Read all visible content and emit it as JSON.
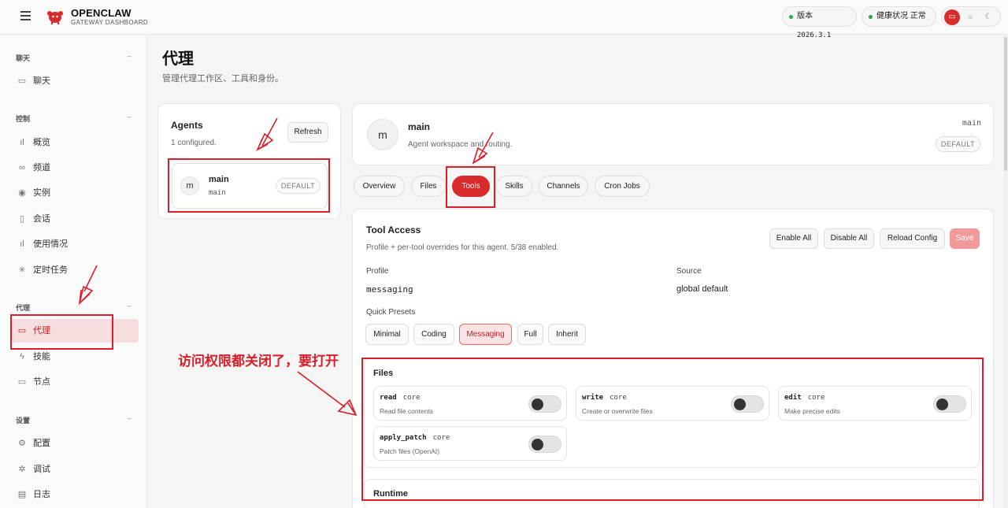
{
  "app": {
    "name": "OPENCLAW",
    "subtitle": "GATEWAY DASHBOARD"
  },
  "status": {
    "version_label": "版本",
    "version": "2026.3.1",
    "health_label": "健康状况",
    "health_value": "正常"
  },
  "sidebar": {
    "sections": [
      {
        "title": "聊天",
        "items": [
          {
            "label": "聊天",
            "icon": "chat-icon"
          }
        ]
      },
      {
        "title": "控制",
        "items": [
          {
            "label": "概览",
            "icon": "bar-chart-icon"
          },
          {
            "label": "频道",
            "icon": "link-icon"
          },
          {
            "label": "实例",
            "icon": "broadcast-icon"
          },
          {
            "label": "会话",
            "icon": "document-icon"
          },
          {
            "label": "使用情况",
            "icon": "bar-chart-icon"
          },
          {
            "label": "定时任务",
            "icon": "loader-icon"
          }
        ]
      },
      {
        "title": "代理",
        "items": [
          {
            "label": "代理",
            "icon": "folder-icon",
            "active": true
          },
          {
            "label": "技能",
            "icon": "zap-icon"
          },
          {
            "label": "节点",
            "icon": "monitor-icon"
          }
        ]
      },
      {
        "title": "设置",
        "items": [
          {
            "label": "配置",
            "icon": "gear-icon"
          },
          {
            "label": "调试",
            "icon": "bug-icon"
          },
          {
            "label": "日志",
            "icon": "log-icon"
          }
        ]
      }
    ]
  },
  "page": {
    "title": "代理",
    "subtitle": "管理代理工作区、工具和身份。"
  },
  "agents_panel": {
    "title": "Agents",
    "count": "1 configured.",
    "refresh": "Refresh",
    "agents": [
      {
        "avatar": "m",
        "name": "main",
        "id": "main",
        "badge": "DEFAULT"
      }
    ]
  },
  "agent_header": {
    "avatar": "m",
    "name": "main",
    "desc": "Agent workspace and routing.",
    "id": "main",
    "badge": "DEFAULT"
  },
  "tabs": [
    {
      "label": "Overview"
    },
    {
      "label": "Files"
    },
    {
      "label": "Tools",
      "active": true
    },
    {
      "label": "Skills"
    },
    {
      "label": "Channels"
    },
    {
      "label": "Cron Jobs"
    }
  ],
  "tool_access": {
    "title": "Tool Access",
    "desc": "Profile + per-tool overrides for this agent. 5/38 enabled.",
    "buttons": {
      "enable_all": "Enable All",
      "disable_all": "Disable All",
      "reload": "Reload Config",
      "save": "Save"
    },
    "profile_label": "Profile",
    "profile_value": "messaging",
    "source_label": "Source",
    "source_value": "global default",
    "presets_label": "Quick Presets",
    "presets": [
      {
        "label": "Minimal"
      },
      {
        "label": "Coding"
      },
      {
        "label": "Messaging",
        "active": true
      },
      {
        "label": "Full"
      },
      {
        "label": "Inherit"
      }
    ],
    "groups": [
      {
        "title": "Files",
        "tools": [
          {
            "name": "read",
            "tag": "core",
            "desc": "Read file contents",
            "enabled": false
          },
          {
            "name": "write",
            "tag": "core",
            "desc": "Create or overwrite files",
            "enabled": false
          },
          {
            "name": "edit",
            "tag": "core",
            "desc": "Make precise edits",
            "enabled": false
          },
          {
            "name": "apply_patch",
            "tag": "core",
            "desc": "Patch files (OpenAI)",
            "enabled": false
          }
        ]
      },
      {
        "title": "Runtime",
        "tools": []
      }
    ]
  },
  "annotation": {
    "text": "访问权限都关闭了，要打开",
    "color": "#d9202a"
  },
  "colors": {
    "accent": "#d92b2b",
    "active_nav_bg": "#f6dede",
    "toggle_off": "#e4e4e4"
  }
}
